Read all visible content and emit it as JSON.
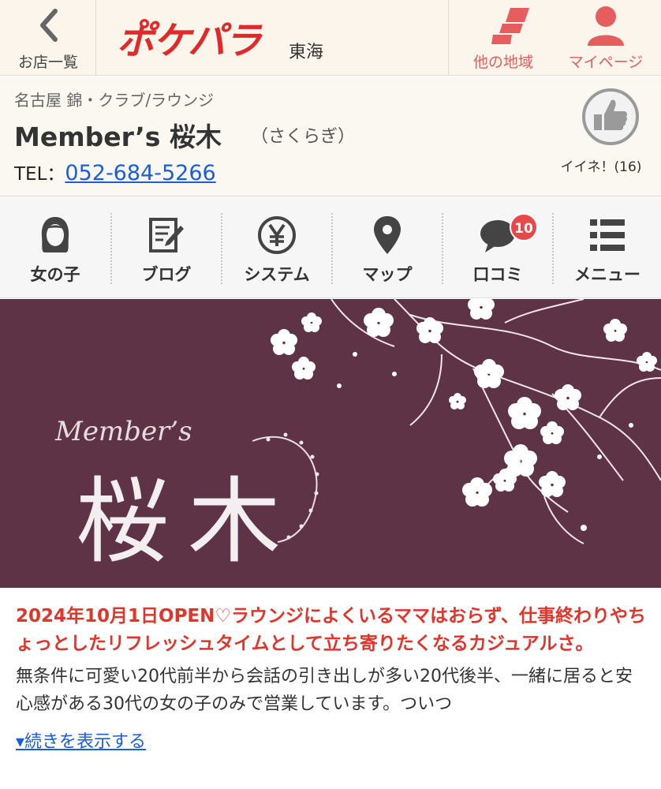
{
  "header": {
    "back_label": "お店一覧",
    "logo_text": "ポケパラ",
    "region": "東海",
    "other_region_label": "他の地域",
    "mypage_label": "マイページ",
    "accent_color": "#e84848"
  },
  "shop": {
    "area": "名古屋 錦・クラブ/ラウンジ",
    "name": "Member’s 桜木",
    "kana": "（さくらぎ）",
    "tel_label": "TEL：",
    "tel_number": "052-684-5266",
    "like_label": "イイネ！(16)"
  },
  "nav": {
    "items": [
      {
        "label": "女の子",
        "icon": "girl-icon"
      },
      {
        "label": "ブログ",
        "icon": "blog-icon"
      },
      {
        "label": "システム",
        "icon": "yen-icon"
      },
      {
        "label": "マップ",
        "icon": "map-pin-icon"
      },
      {
        "label": "口コミ",
        "icon": "speech-bubble-icon",
        "badge": "10"
      },
      {
        "label": "メニュー",
        "icon": "menu-list-icon"
      }
    ]
  },
  "hero": {
    "members_text": "Member’s",
    "kanji_text": "桜木",
    "bg_color": "#5e3346"
  },
  "description": {
    "lead": "2024年10月1日OPEN♡ラウンジによくいるママはおらず、仕事終わりやちょっとしたリフレッシュタイムとして立ち寄りたくなるカジュアルさ。",
    "body": "無条件に可愛い20代前半から会話の引き出しが多い20代後半、一緒に居ると安心感がある30代の女の子のみで営業しています。ついつ",
    "more_link": "▾続きを表示する"
  }
}
